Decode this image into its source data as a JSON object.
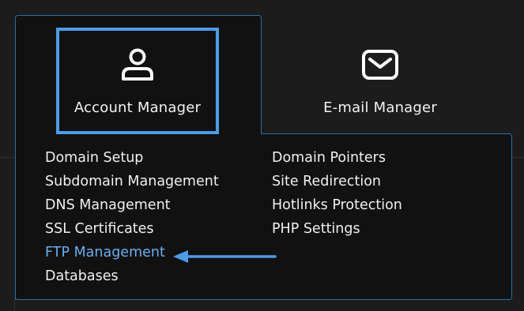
{
  "tiles": [
    {
      "label": "Account Manager",
      "icon": "user-icon",
      "selected": true
    },
    {
      "label": "E-mail Manager",
      "icon": "envelope-icon",
      "selected": false
    }
  ],
  "menu": {
    "left": [
      {
        "label": "Domain Setup"
      },
      {
        "label": "Subdomain Management"
      },
      {
        "label": "DNS Management"
      },
      {
        "label": "SSL Certificates"
      },
      {
        "label": "FTP Management",
        "highlighted": true
      },
      {
        "label": "Databases"
      }
    ],
    "right": [
      {
        "label": "Domain Pointers"
      },
      {
        "label": "Site Redirection"
      },
      {
        "label": "Hotlinks Protection"
      },
      {
        "label": "PHP Settings"
      }
    ]
  },
  "colors": {
    "accent": "#4d9be6",
    "highlight_text": "#6aaef0",
    "panel_bg": "#111111",
    "page_bg": "#1c1c1c",
    "panel_border": "#2a6fa8"
  }
}
